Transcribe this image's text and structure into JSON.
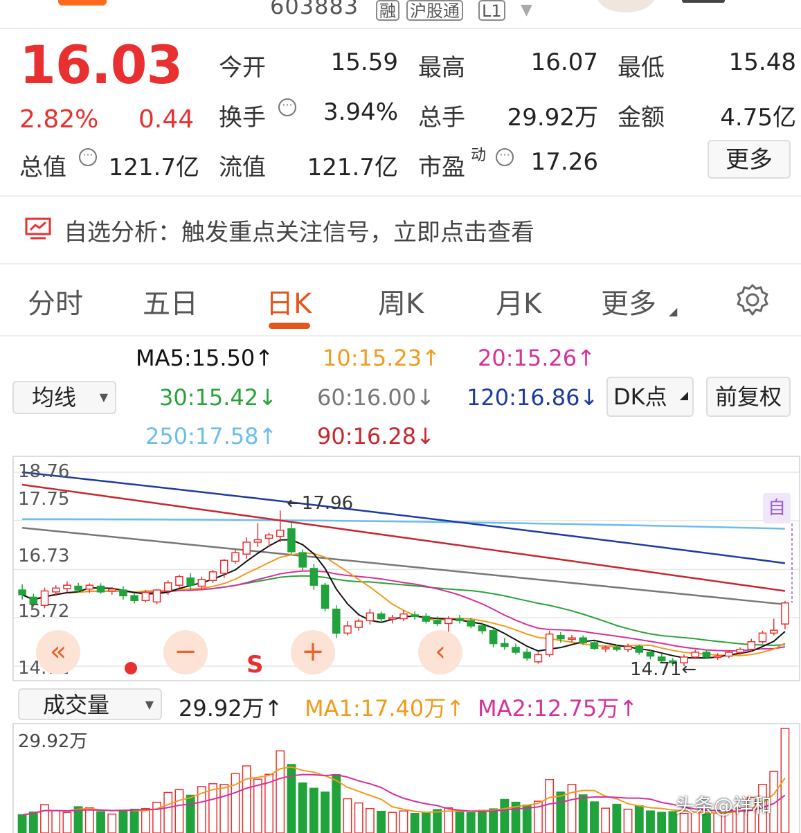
{
  "header": {
    "code": "603883",
    "tags": [
      "融",
      "沪股通",
      "L1"
    ]
  },
  "quote": {
    "price": "16.03",
    "change_pct": "2.82%",
    "change_amt": "0.44",
    "open_label": "今开",
    "open": "15.59",
    "high_label": "最高",
    "high": "16.07",
    "low_label": "最低",
    "low": "15.48",
    "turnover_label": "换手",
    "turnover": "3.94%",
    "volume_label": "总手",
    "volume": "29.92万",
    "amount_label": "金额",
    "amount": "4.75亿",
    "mktcap_label": "总值",
    "mktcap": "121.7亿",
    "float_label": "流值",
    "float": "121.7亿",
    "pe_label": "市盈",
    "pe_sup": "动",
    "pe": "17.26",
    "more_label": "更多"
  },
  "analysis": {
    "text": "自选分析：触发重点关注信号，立即点击查看"
  },
  "tabs": [
    "分时",
    "五日",
    "日K",
    "周K",
    "月K",
    "更多"
  ],
  "ma": {
    "ma5": "MA5:15.50↑",
    "ma10": "10:15.23↑",
    "ma20": "20:15.26↑",
    "ma30": "30:15.42↓",
    "ma60": "60:16.00↓",
    "ma120": "120:16.86↓",
    "ma250": "250:17.58↑",
    "ma90": "90:16.28↓",
    "selector": "均线",
    "dk_label": "DK点",
    "adjust_label": "前复权"
  },
  "colors": {
    "up": "#e93030",
    "down": "#1fa33a",
    "ma5": "#111111",
    "ma10": "#f29a1c",
    "ma20": "#d6309b",
    "ma30": "#27a338",
    "ma60": "#777777",
    "ma120": "#1d3b9f",
    "ma250": "#6bbdf0",
    "ma90": "#c8262e",
    "accent": "#e4561c"
  },
  "kline": {
    "axis_labels": [
      "18.76",
      "17.75",
      "16.73",
      "15.72",
      "14.71"
    ],
    "high_mark": "←17.96",
    "low_mark": "14.71←",
    "self_tag": "自",
    "controls": [
      "«",
      "−",
      "S",
      "+",
      "‹"
    ]
  },
  "volume": {
    "selector": "成交量",
    "current": "29.92万↑",
    "ma1": "MA1:17.40万↑",
    "ma2": "MA2:12.75万↑",
    "axis_top": "29.92万"
  },
  "chart_data": {
    "type": "candlestick",
    "y_range": [
      14.71,
      18.76
    ],
    "y_ticks": [
      18.76,
      17.75,
      16.73,
      15.72,
      14.71
    ],
    "candles": [
      {
        "o": 16.3,
        "h": 16.42,
        "l": 16.1,
        "c": 16.2
      },
      {
        "o": 16.15,
        "h": 16.22,
        "l": 15.95,
        "c": 16.0
      },
      {
        "o": 15.98,
        "h": 16.35,
        "l": 15.92,
        "c": 16.28
      },
      {
        "o": 16.26,
        "h": 16.4,
        "l": 16.18,
        "c": 16.34
      },
      {
        "o": 16.33,
        "h": 16.48,
        "l": 16.25,
        "c": 16.4
      },
      {
        "o": 16.38,
        "h": 16.45,
        "l": 16.25,
        "c": 16.3
      },
      {
        "o": 16.32,
        "h": 16.44,
        "l": 16.24,
        "c": 16.4
      },
      {
        "o": 16.38,
        "h": 16.44,
        "l": 16.22,
        "c": 16.26
      },
      {
        "o": 16.28,
        "h": 16.36,
        "l": 16.2,
        "c": 16.32
      },
      {
        "o": 16.3,
        "h": 16.38,
        "l": 16.1,
        "c": 16.18
      },
      {
        "o": 16.18,
        "h": 16.24,
        "l": 16.02,
        "c": 16.08
      },
      {
        "o": 16.08,
        "h": 16.3,
        "l": 16.04,
        "c": 16.25
      },
      {
        "o": 16.05,
        "h": 16.32,
        "l": 16.0,
        "c": 16.3
      },
      {
        "o": 16.28,
        "h": 16.5,
        "l": 16.2,
        "c": 16.45
      },
      {
        "o": 16.4,
        "h": 16.62,
        "l": 16.35,
        "c": 16.58
      },
      {
        "o": 16.55,
        "h": 16.65,
        "l": 16.3,
        "c": 16.4
      },
      {
        "o": 16.38,
        "h": 16.58,
        "l": 16.3,
        "c": 16.52
      },
      {
        "o": 16.5,
        "h": 16.72,
        "l": 16.45,
        "c": 16.68
      },
      {
        "o": 16.65,
        "h": 16.95,
        "l": 16.55,
        "c": 16.92
      },
      {
        "o": 16.9,
        "h": 17.15,
        "l": 16.85,
        "c": 17.08
      },
      {
        "o": 17.05,
        "h": 17.4,
        "l": 16.95,
        "c": 17.3
      },
      {
        "o": 17.3,
        "h": 17.7,
        "l": 17.2,
        "c": 17.35
      },
      {
        "o": 17.38,
        "h": 17.5,
        "l": 17.2,
        "c": 17.45
      },
      {
        "o": 17.42,
        "h": 17.96,
        "l": 17.3,
        "c": 17.55
      },
      {
        "o": 17.58,
        "h": 17.7,
        "l": 17.05,
        "c": 17.1
      },
      {
        "o": 17.08,
        "h": 17.15,
        "l": 16.7,
        "c": 16.78
      },
      {
        "o": 16.75,
        "h": 16.85,
        "l": 16.3,
        "c": 16.4
      },
      {
        "o": 16.4,
        "h": 16.45,
        "l": 15.85,
        "c": 15.92
      },
      {
        "o": 15.9,
        "h": 15.98,
        "l": 15.3,
        "c": 15.4
      },
      {
        "o": 15.4,
        "h": 15.65,
        "l": 15.35,
        "c": 15.55
      },
      {
        "o": 15.52,
        "h": 15.7,
        "l": 15.45,
        "c": 15.65
      },
      {
        "o": 15.66,
        "h": 15.9,
        "l": 15.58,
        "c": 15.82
      },
      {
        "o": 15.8,
        "h": 15.85,
        "l": 15.62,
        "c": 15.7
      },
      {
        "o": 15.7,
        "h": 15.78,
        "l": 15.6,
        "c": 15.72
      },
      {
        "o": 15.7,
        "h": 15.88,
        "l": 15.65,
        "c": 15.8
      },
      {
        "o": 15.78,
        "h": 15.85,
        "l": 15.68,
        "c": 15.75
      },
      {
        "o": 15.75,
        "h": 15.82,
        "l": 15.6,
        "c": 15.65
      },
      {
        "o": 15.66,
        "h": 15.75,
        "l": 15.55,
        "c": 15.6
      },
      {
        "o": 15.6,
        "h": 15.75,
        "l": 15.3,
        "c": 15.7
      },
      {
        "o": 15.7,
        "h": 15.78,
        "l": 15.6,
        "c": 15.66
      },
      {
        "o": 15.66,
        "h": 15.72,
        "l": 15.5,
        "c": 15.55
      },
      {
        "o": 15.55,
        "h": 15.62,
        "l": 15.38,
        "c": 15.45
      },
      {
        "o": 15.45,
        "h": 15.5,
        "l": 15.1,
        "c": 15.18
      },
      {
        "o": 15.18,
        "h": 15.3,
        "l": 15.05,
        "c": 15.12
      },
      {
        "o": 15.1,
        "h": 15.18,
        "l": 14.95,
        "c": 15.0
      },
      {
        "o": 15.0,
        "h": 15.08,
        "l": 14.82,
        "c": 14.88
      },
      {
        "o": 14.8,
        "h": 15.0,
        "l": 14.76,
        "c": 14.95
      },
      {
        "o": 14.95,
        "h": 15.45,
        "l": 14.9,
        "c": 15.38
      },
      {
        "o": 15.35,
        "h": 15.42,
        "l": 15.2,
        "c": 15.28
      },
      {
        "o": 15.28,
        "h": 15.36,
        "l": 15.2,
        "c": 15.3
      },
      {
        "o": 15.3,
        "h": 15.35,
        "l": 15.15,
        "c": 15.2
      },
      {
        "o": 15.2,
        "h": 15.24,
        "l": 15.05,
        "c": 15.08
      },
      {
        "o": 15.08,
        "h": 15.14,
        "l": 15.0,
        "c": 15.1
      },
      {
        "o": 15.1,
        "h": 15.16,
        "l": 15.02,
        "c": 15.06
      },
      {
        "o": 15.06,
        "h": 15.18,
        "l": 15.0,
        "c": 15.12
      },
      {
        "o": 15.12,
        "h": 15.16,
        "l": 14.95,
        "c": 15.0
      },
      {
        "o": 15.0,
        "h": 15.06,
        "l": 14.85,
        "c": 14.92
      },
      {
        "o": 14.9,
        "h": 14.96,
        "l": 14.78,
        "c": 14.82
      },
      {
        "o": 14.82,
        "h": 14.88,
        "l": 14.71,
        "c": 14.78
      },
      {
        "o": 14.78,
        "h": 14.95,
        "l": 14.71,
        "c": 14.9
      },
      {
        "o": 14.9,
        "h": 15.05,
        "l": 14.86,
        "c": 15.0
      },
      {
        "o": 15.0,
        "h": 15.04,
        "l": 14.86,
        "c": 14.9
      },
      {
        "o": 14.9,
        "h": 14.98,
        "l": 14.84,
        "c": 14.92
      },
      {
        "o": 14.92,
        "h": 15.04,
        "l": 14.88,
        "c": 15.0
      },
      {
        "o": 15.0,
        "h": 15.1,
        "l": 14.95,
        "c": 15.06
      },
      {
        "o": 15.06,
        "h": 15.28,
        "l": 15.0,
        "c": 15.22
      },
      {
        "o": 15.22,
        "h": 15.45,
        "l": 15.18,
        "c": 15.4
      },
      {
        "o": 15.4,
        "h": 15.7,
        "l": 15.35,
        "c": 15.46
      },
      {
        "o": 15.59,
        "h": 16.07,
        "l": 15.48,
        "c": 16.03
      }
    ],
    "volume": [
      5.2,
      6.0,
      8.1,
      6.4,
      5.9,
      7.5,
      7.2,
      6.1,
      5.4,
      6.6,
      6.8,
      7.0,
      8.8,
      11.6,
      12.4,
      10.8,
      13.3,
      14.1,
      13.9,
      17.0,
      19.2,
      15.4,
      16.8,
      23.5,
      19.6,
      14.3,
      12.8,
      11.7,
      16.7,
      9.8,
      8.6,
      7.0,
      6.2,
      5.9,
      6.3,
      5.6,
      5.7,
      6.7,
      7.2,
      6.0,
      5.8,
      6.5,
      6.9,
      9.6,
      8.8,
      8.0,
      9.1,
      15.3,
      11.7,
      13.9,
      10.9,
      8.9,
      7.1,
      8.2,
      6.8,
      7.8,
      6.3,
      5.9,
      6.1,
      5.6,
      6.0,
      5.5,
      5.7,
      6.6,
      7.1,
      10.2,
      13.9,
      17.6,
      29.92
    ],
    "volume_max": 29.92
  }
}
